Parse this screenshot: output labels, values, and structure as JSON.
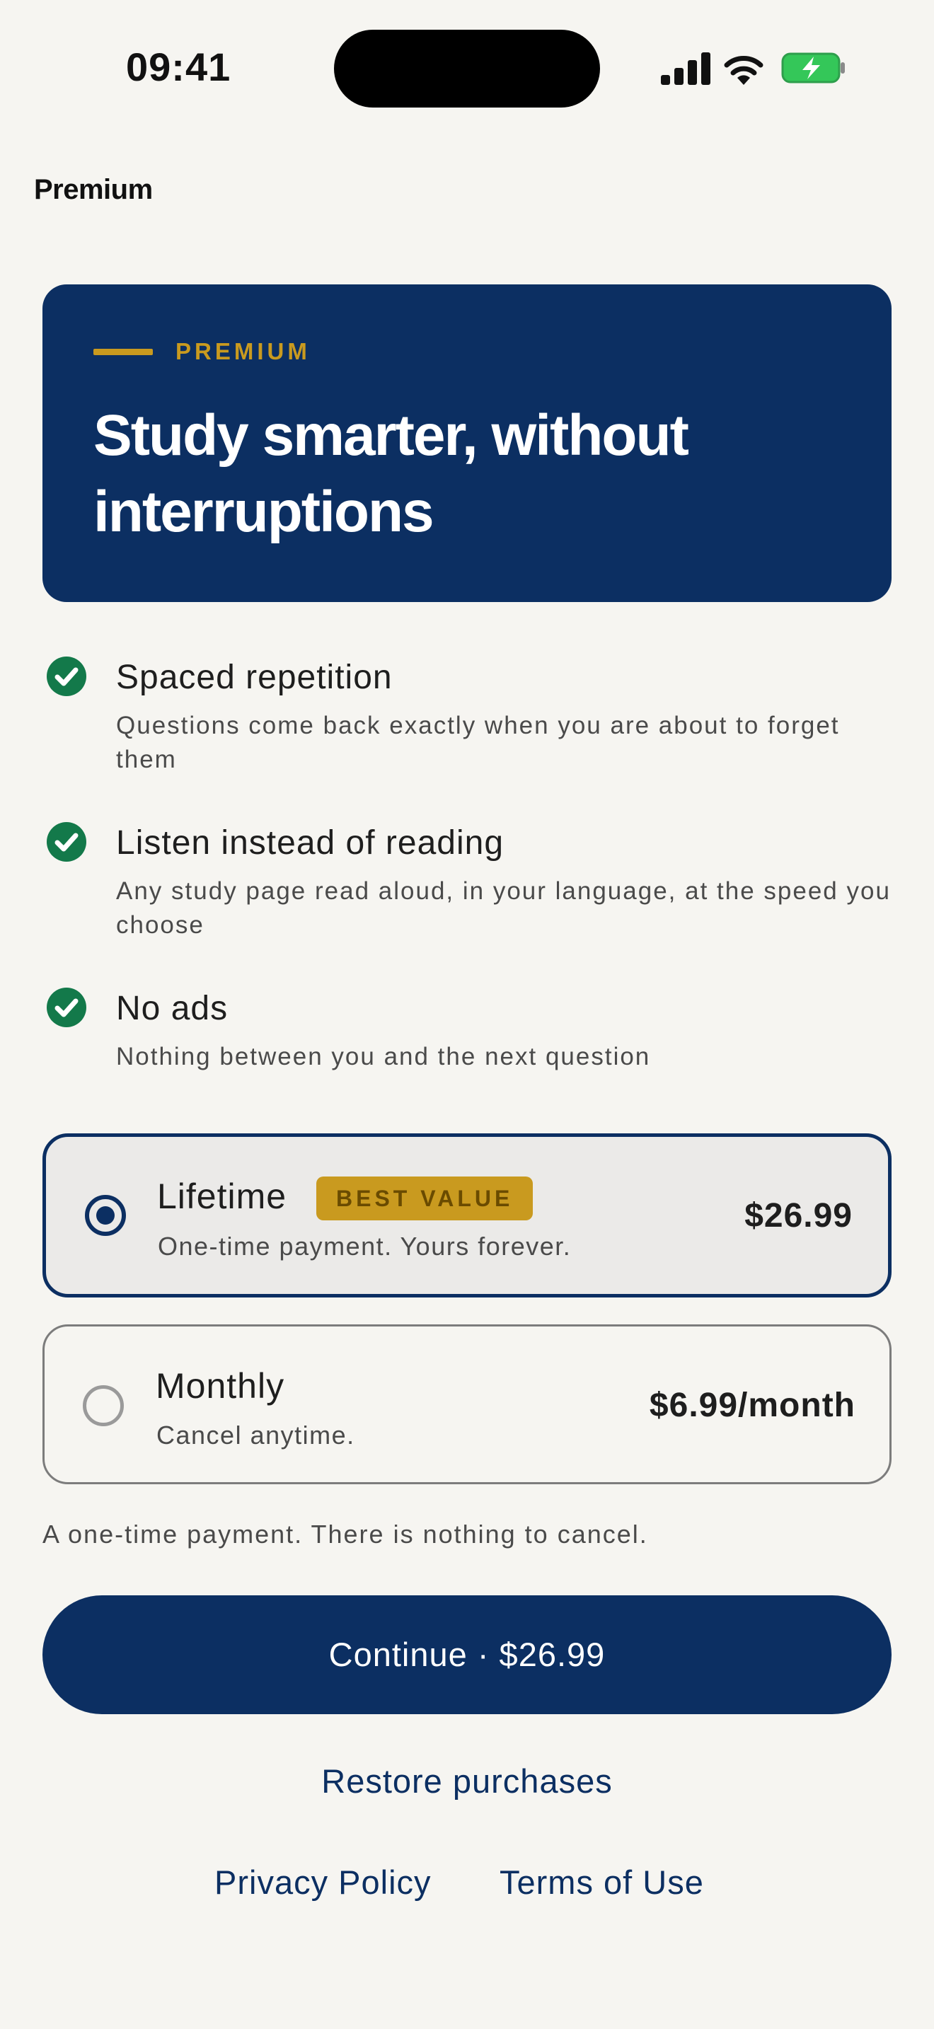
{
  "status_bar": {
    "time": "09:41",
    "icons": [
      "cellular-signal-icon",
      "wifi-icon",
      "battery-charging-icon"
    ],
    "battery_color": "#34c759"
  },
  "nav": {
    "title": "Premium"
  },
  "hero": {
    "eyebrow": "PREMIUM",
    "title": "Study smarter, without interruptions",
    "background_color": "#0c2f62",
    "accent_color": "#c99a1f"
  },
  "features": [
    {
      "title": "Spaced repetition",
      "description": "Questions come back exactly when you are about to forget them",
      "icon": "check-circle-icon"
    },
    {
      "title": "Listen instead of reading",
      "description": "Any study page read aloud, in your language, at the speed you choose",
      "icon": "check-circle-icon"
    },
    {
      "title": "No ads",
      "description": "Nothing between you and the next question",
      "icon": "check-circle-icon"
    }
  ],
  "plans": {
    "lifetime": {
      "name": "Lifetime",
      "badge": "BEST VALUE",
      "subtitle": "One-time payment. Yours forever.",
      "price": "$26.99",
      "selected": true
    },
    "monthly": {
      "name": "Monthly",
      "subtitle": "Cancel anytime.",
      "price": "$6.99/month",
      "selected": false
    }
  },
  "note": "A one-time payment. There is nothing to cancel.",
  "cta": {
    "label": "Continue · $26.99"
  },
  "links": {
    "restore": "Restore purchases",
    "privacy": "Privacy Policy",
    "terms": "Terms of Use"
  },
  "colors": {
    "background": "#f6f5f1",
    "primary": "#0c2f62",
    "check": "#13794a",
    "gold": "#c99a1f"
  }
}
